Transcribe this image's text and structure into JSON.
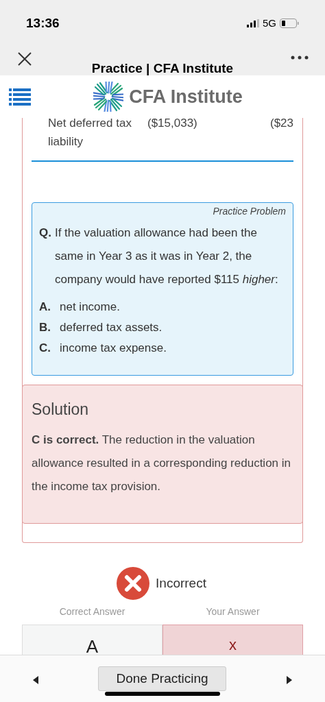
{
  "status_bar": {
    "time": "13:36",
    "network": "5G"
  },
  "browser": {
    "title": "Practice | CFA Institute"
  },
  "header": {
    "logo_text": "CFA Institute"
  },
  "table_row": {
    "label": "Net deferred tax liability",
    "values": [
      "($15,033)",
      "($23"
    ]
  },
  "problem": {
    "tag": "Practice Problem",
    "question_label": "Q.",
    "question": "If the valuation allowance had been the same in Year 3 as it was in Year 2, the company would have reported $115 *higher*:",
    "options": [
      {
        "letter": "A.",
        "text": "net income."
      },
      {
        "letter": "B.",
        "text": "deferred tax assets."
      },
      {
        "letter": "C.",
        "text": "income tax expense."
      }
    ]
  },
  "solution": {
    "title": "Solution",
    "text": "**C is correct.** The reduction in the valuation allowance resulted in a corresponding reduction in the income tax provision."
  },
  "result": {
    "kind": "incorrect",
    "label": "Incorrect"
  },
  "answers": [
    {
      "kind": "correct",
      "heading": "Correct Answer",
      "value": "A"
    },
    {
      "kind": "wrong",
      "heading": "Your Answer",
      "value": "x"
    }
  ],
  "footer": {
    "button": "Done Practicing"
  }
}
